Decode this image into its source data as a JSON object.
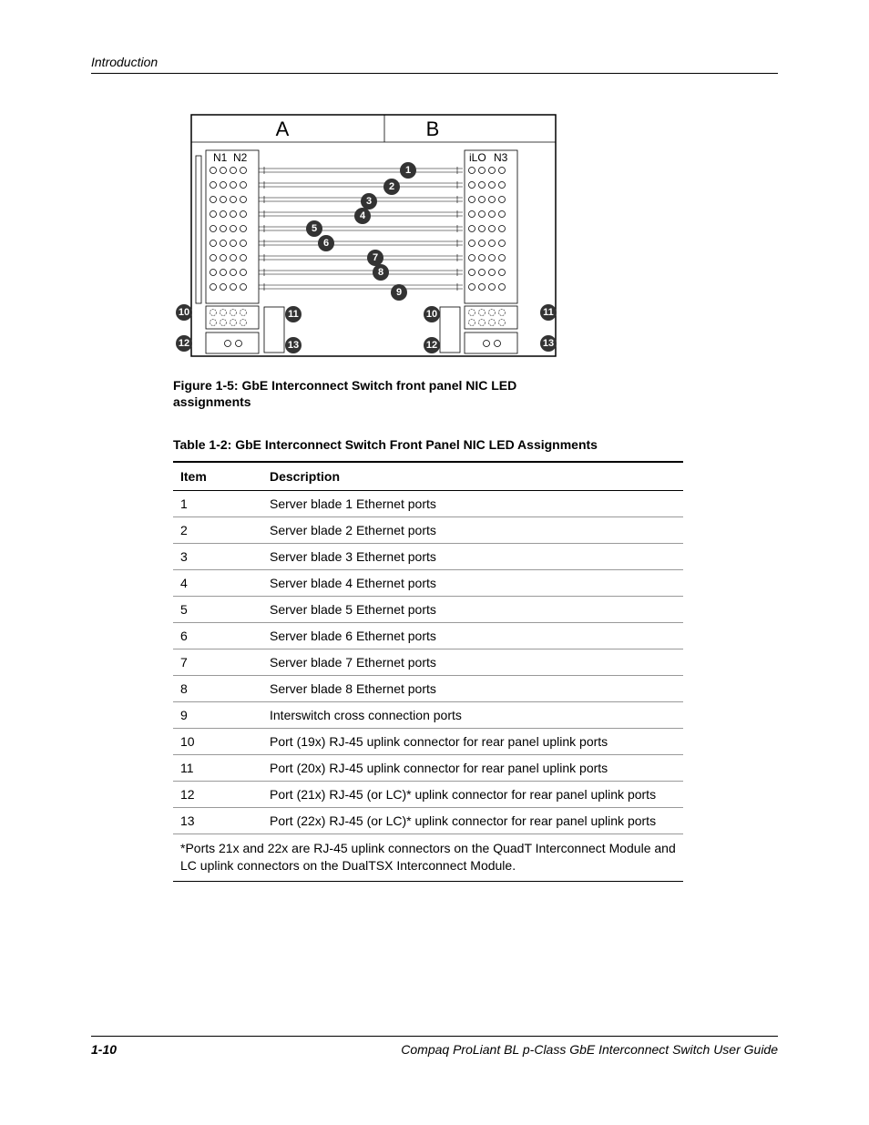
{
  "header": "Introduction",
  "figure": {
    "caption": "Figure 1-5:  GbE Interconnect Switch front panel NIC LED assignments",
    "labels": {
      "A": "A",
      "B": "B",
      "N1": "N1",
      "N2": "N2",
      "iLO": "iLO",
      "N3": "N3"
    },
    "callouts": [
      "1",
      "2",
      "3",
      "4",
      "5",
      "6",
      "7",
      "8",
      "9",
      "10",
      "11",
      "12",
      "13",
      "10",
      "11",
      "12",
      "13"
    ]
  },
  "table": {
    "title": "Table 1-2:  GbE Interconnect Switch Front Panel NIC LED Assignments",
    "headers": {
      "item": "Item",
      "description": "Description"
    },
    "rows": [
      {
        "item": "1",
        "description": "Server blade 1 Ethernet ports"
      },
      {
        "item": "2",
        "description": "Server blade 2 Ethernet ports"
      },
      {
        "item": "3",
        "description": "Server blade 3 Ethernet ports"
      },
      {
        "item": "4",
        "description": "Server blade 4 Ethernet ports"
      },
      {
        "item": "5",
        "description": "Server blade 5 Ethernet ports"
      },
      {
        "item": "6",
        "description": "Server blade 6 Ethernet ports"
      },
      {
        "item": "7",
        "description": "Server blade 7 Ethernet ports"
      },
      {
        "item": "8",
        "description": "Server blade 8 Ethernet ports"
      },
      {
        "item": "9",
        "description": "Interswitch cross connection ports"
      },
      {
        "item": "10",
        "description": "Port (19x) RJ-45 uplink connector for rear panel uplink ports"
      },
      {
        "item": "11",
        "description": "Port (20x) RJ-45 uplink connector for rear panel uplink ports"
      },
      {
        "item": "12",
        "description": "Port (21x) RJ-45 (or LC)* uplink connector for rear panel uplink ports"
      },
      {
        "item": "13",
        "description": "Port (22x) RJ-45 (or LC)* uplink connector for rear panel uplink ports"
      }
    ],
    "footnote": "*Ports 21x and 22x are RJ-45 uplink connectors on the QuadT Interconnect Module and LC uplink connectors on the DualTSX Interconnect Module."
  },
  "footer": {
    "page": "1-10",
    "title": "Compaq ProLiant BL p-Class GbE Interconnect Switch User Guide"
  }
}
